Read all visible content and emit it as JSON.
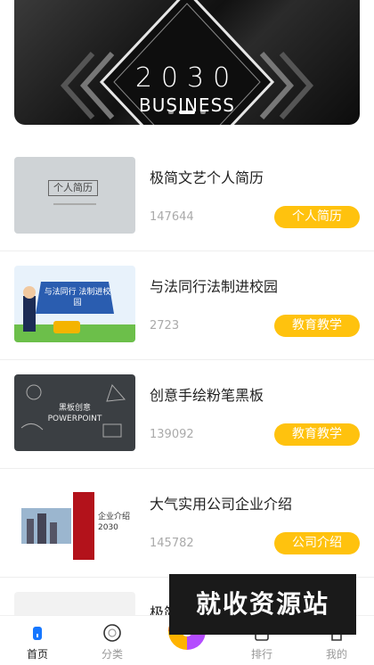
{
  "banner": {
    "year": "2030",
    "subtitle": "BUSINESS",
    "dots": [
      false,
      true,
      false
    ]
  },
  "items": [
    {
      "title": "极简文艺个人简历",
      "count": "147644",
      "tag": "个人简历",
      "thumb_text": "个人简历"
    },
    {
      "title": "与法同行法制进校园",
      "count": "2723",
      "tag": "教育教学",
      "thumb_text": "与法同行 法制进校园"
    },
    {
      "title": "创意手绘粉笔黑板",
      "count": "139092",
      "tag": "教育教学",
      "thumb_text": "黑板创意 POWERPOINT"
    },
    {
      "title": "大气实用公司企业介绍",
      "count": "145782",
      "tag": "公司介绍",
      "thumb_text": "企业介绍 2030"
    },
    {
      "title": "极简",
      "count": "",
      "tag": ""
    }
  ],
  "watermark": "就收资源站",
  "tabs": [
    {
      "label": "首页",
      "icon": "home-icon",
      "active": true
    },
    {
      "label": "分类",
      "icon": "category-icon",
      "active": false
    },
    {
      "label": "",
      "icon": "center-logo-icon",
      "active": false
    },
    {
      "label": "排行",
      "icon": "ranking-icon",
      "active": false
    },
    {
      "label": "我的",
      "icon": "profile-icon",
      "active": false
    }
  ],
  "colors": {
    "accent": "#ffc20e",
    "tab_active": "#1677ff"
  }
}
